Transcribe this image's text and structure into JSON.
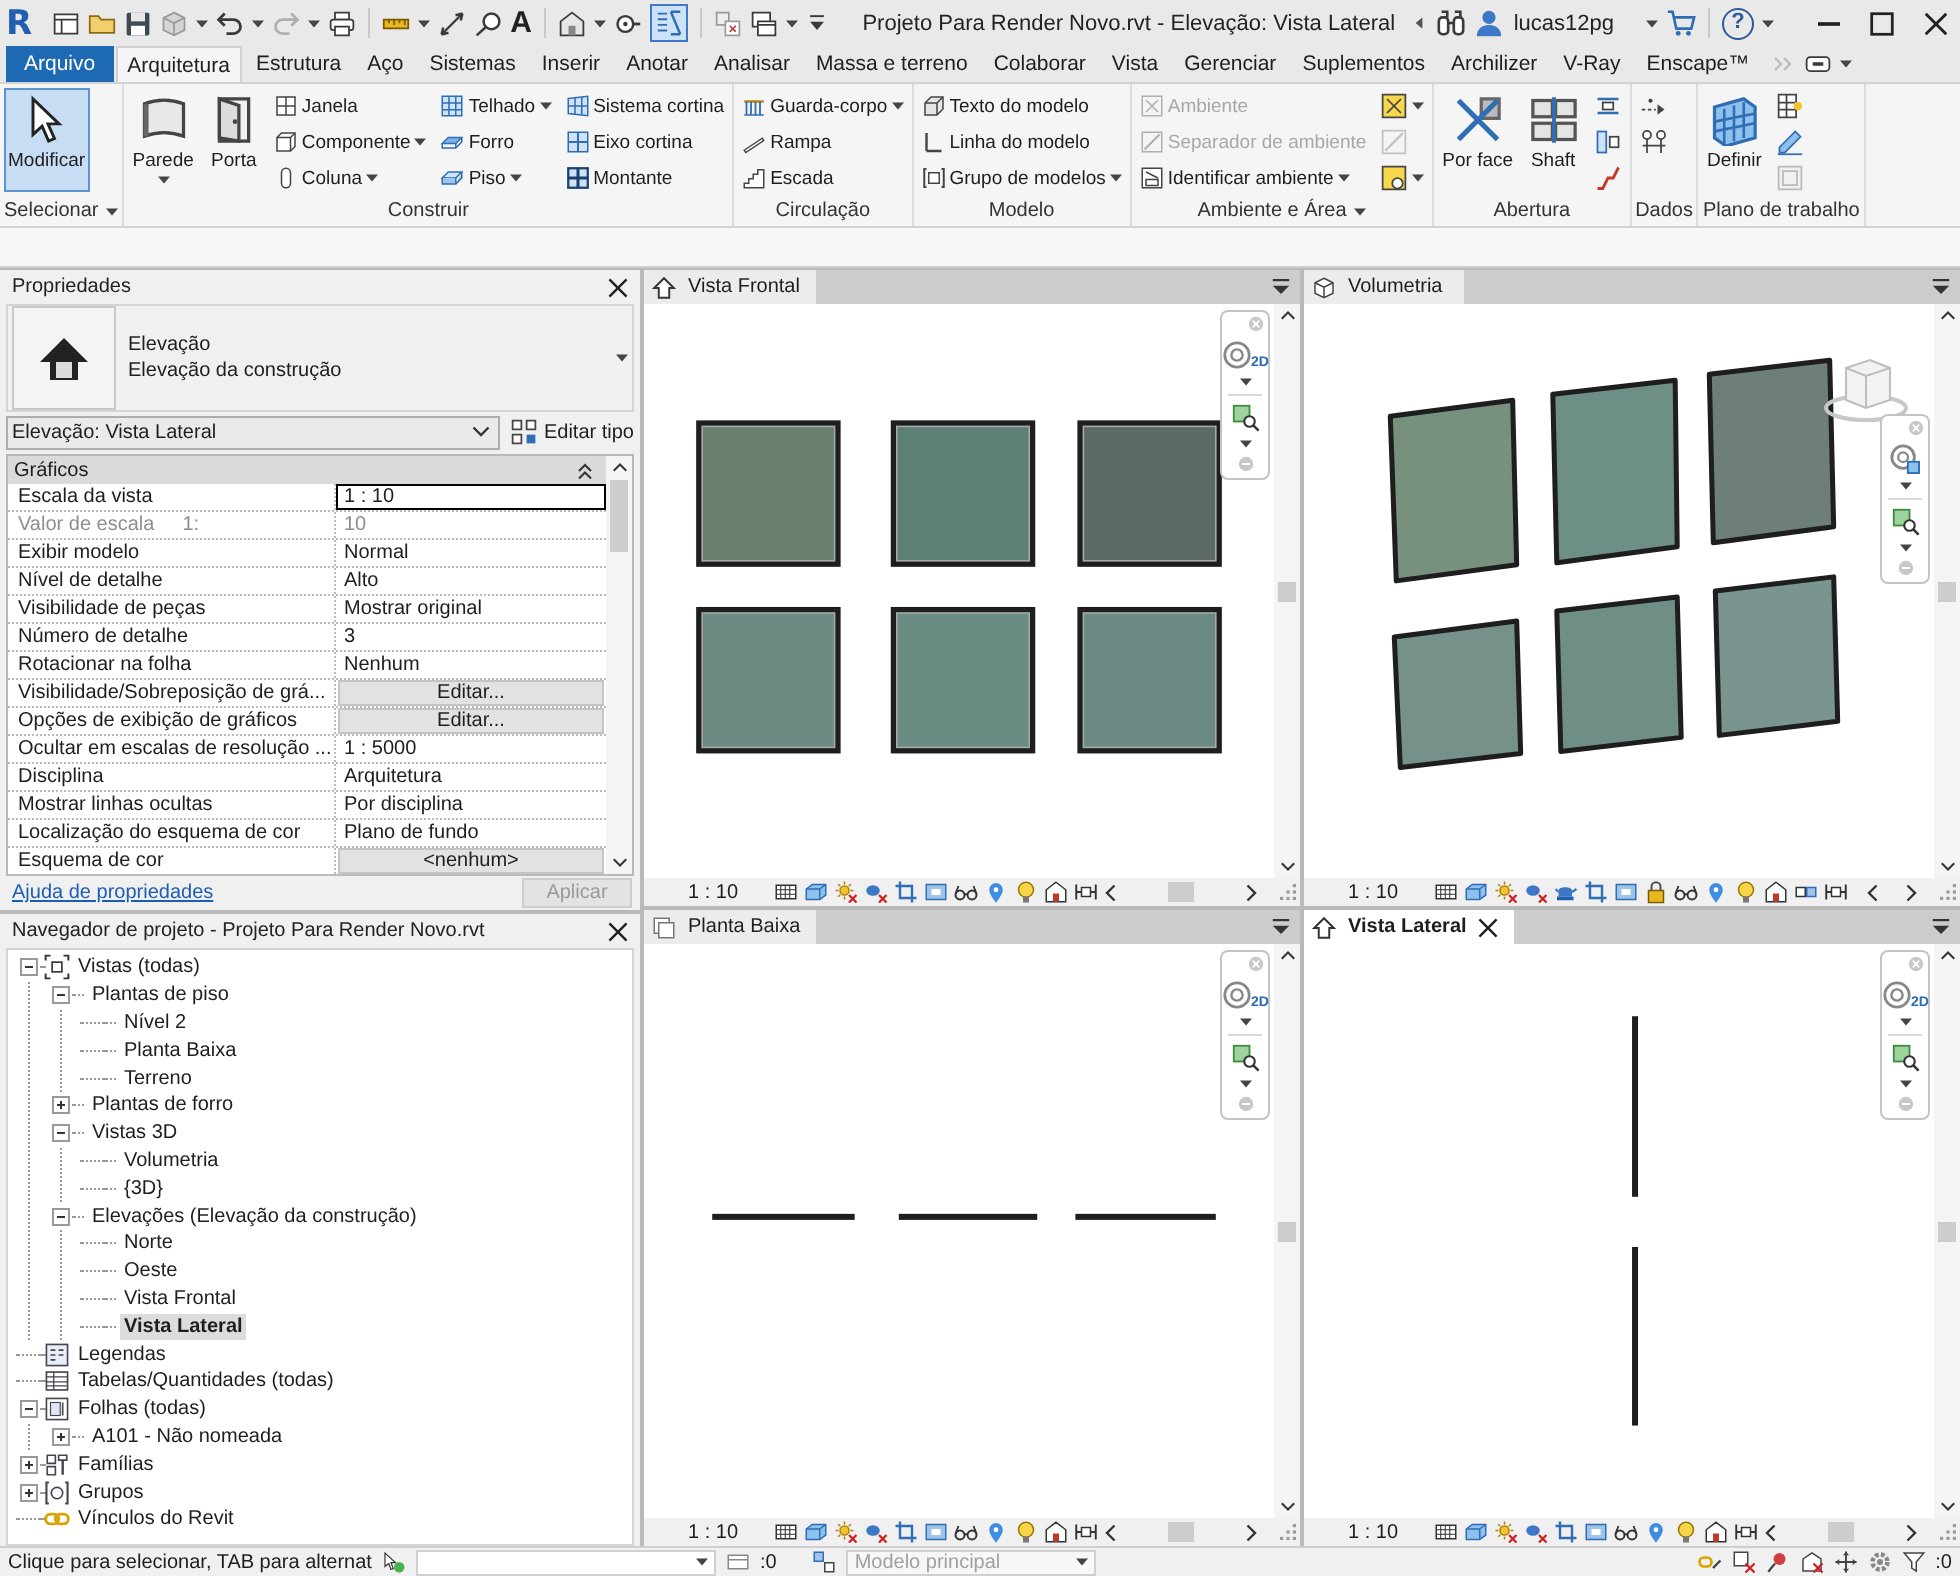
{
  "title_bar": {
    "logo": "R",
    "text_tool": "A",
    "thin_lines_selected": true,
    "title": "Projeto Para Render Novo.rvt - Elevação: Vista Lateral",
    "user": "lucas12pg",
    "help": "?"
  },
  "ribbon": {
    "tabs": [
      {
        "label": "Arquivo",
        "kind": "application",
        "selected": false
      },
      {
        "label": "Arquitetura",
        "kind": "tab",
        "selected": true
      },
      {
        "label": "Estrutura",
        "kind": "tab",
        "selected": false
      },
      {
        "label": "Aço",
        "kind": "tab",
        "selected": false
      },
      {
        "label": "Sistemas",
        "kind": "tab",
        "selected": false
      },
      {
        "label": "Inserir",
        "kind": "tab",
        "selected": false
      },
      {
        "label": "Anotar",
        "kind": "tab",
        "selected": false
      },
      {
        "label": "Analisar",
        "kind": "tab",
        "selected": false
      },
      {
        "label": "Massa e terreno",
        "kind": "tab",
        "selected": false
      },
      {
        "label": "Colaborar",
        "kind": "tab",
        "selected": false
      },
      {
        "label": "Vista",
        "kind": "tab",
        "selected": false
      },
      {
        "label": "Gerenciar",
        "kind": "tab",
        "selected": false
      },
      {
        "label": "Suplementos",
        "kind": "tab",
        "selected": false
      },
      {
        "label": "Archilizer",
        "kind": "tab",
        "selected": false
      },
      {
        "label": "V-Ray",
        "kind": "tab",
        "selected": false
      },
      {
        "label": "Enscape™",
        "kind": "tab",
        "selected": false
      }
    ],
    "panels": [
      {
        "title": "Selecionar",
        "has_menu": true,
        "columns": [
          [
            {
              "kind": "large",
              "label": "Modificar",
              "selected": true,
              "disabled": false,
              "has_menu": false
            }
          ]
        ]
      },
      {
        "title": "Construir",
        "has_menu": false,
        "columns": [
          [
            {
              "kind": "large",
              "label": "Parede",
              "selected": false,
              "disabled": false,
              "has_menu": true
            }
          ],
          [
            {
              "kind": "large",
              "label": "Porta",
              "selected": false,
              "disabled": false,
              "has_menu": false
            }
          ],
          [
            {
              "kind": "small",
              "label": "Janela",
              "selected": false,
              "disabled": false,
              "has_menu": false
            },
            {
              "kind": "small",
              "label": "Componente",
              "selected": false,
              "disabled": false,
              "has_menu": true
            },
            {
              "kind": "small",
              "label": "Coluna",
              "selected": false,
              "disabled": false,
              "has_menu": true
            }
          ],
          [
            {
              "kind": "small",
              "label": "Telhado",
              "selected": false,
              "disabled": false,
              "has_menu": true
            },
            {
              "kind": "small",
              "label": "Forro",
              "selected": false,
              "disabled": false,
              "has_menu": false
            },
            {
              "kind": "small",
              "label": "Piso",
              "selected": false,
              "disabled": false,
              "has_menu": true
            }
          ],
          [
            {
              "kind": "small",
              "label": "Sistema cortina",
              "selected": false,
              "disabled": false,
              "has_menu": false
            },
            {
              "kind": "small",
              "label": "Eixo cortina",
              "selected": false,
              "disabled": false,
              "has_menu": false
            },
            {
              "kind": "small",
              "label": "Montante",
              "selected": false,
              "disabled": false,
              "has_menu": false
            }
          ]
        ]
      },
      {
        "title": "Circulação",
        "has_menu": false,
        "columns": [
          [
            {
              "kind": "small",
              "label": "Guarda-corpo",
              "selected": false,
              "disabled": false,
              "has_menu": true
            },
            {
              "kind": "small",
              "label": "Rampa",
              "selected": false,
              "disabled": false,
              "has_menu": false
            },
            {
              "kind": "small",
              "label": "Escada",
              "selected": false,
              "disabled": false,
              "has_menu": false
            }
          ]
        ]
      },
      {
        "title": "Modelo",
        "has_menu": false,
        "columns": [
          [
            {
              "kind": "small",
              "label": "Texto do modelo",
              "selected": false,
              "disabled": false,
              "has_menu": false
            },
            {
              "kind": "small",
              "label": "Linha do modelo",
              "selected": false,
              "disabled": false,
              "has_menu": false
            },
            {
              "kind": "small",
              "label": "Grupo de modelos",
              "selected": false,
              "disabled": false,
              "has_menu": true
            }
          ]
        ]
      },
      {
        "title": "Ambiente e Área",
        "has_menu": true,
        "columns": [
          [
            {
              "kind": "small",
              "label": "Ambiente",
              "selected": false,
              "disabled": true,
              "has_menu": false
            },
            {
              "kind": "small",
              "label": "Separador de ambiente",
              "selected": false,
              "disabled": true,
              "has_menu": false
            },
            {
              "kind": "small",
              "label": "Identificar ambiente",
              "selected": false,
              "disabled": false,
              "has_menu": true
            }
          ],
          [
            {
              "kind": "icon",
              "selected": false,
              "disabled": false,
              "has_menu": true
            },
            {
              "kind": "icon",
              "selected": false,
              "disabled": true,
              "has_menu": false
            },
            {
              "kind": "icon",
              "selected": false,
              "disabled": false,
              "has_menu": true
            }
          ]
        ]
      },
      {
        "title": "Abertura",
        "has_menu": false,
        "columns": [
          [
            {
              "kind": "large",
              "label": "Por face",
              "selected": false,
              "disabled": false,
              "has_menu": false
            }
          ],
          [
            {
              "kind": "large",
              "label": "Shaft",
              "selected": false,
              "disabled": false,
              "has_menu": false
            }
          ],
          [
            {
              "kind": "icon",
              "selected": false,
              "disabled": false,
              "has_menu": false
            },
            {
              "kind": "icon",
              "selected": false,
              "disabled": false,
              "has_menu": false
            },
            {
              "kind": "icon",
              "selected": false,
              "disabled": false,
              "has_menu": false
            }
          ]
        ]
      },
      {
        "title": "Dados",
        "has_menu": false,
        "columns": [
          [
            {
              "kind": "icon",
              "selected": false,
              "disabled": false,
              "has_menu": false
            },
            {
              "kind": "icon",
              "selected": false,
              "disabled": false,
              "has_menu": false
            }
          ]
        ]
      },
      {
        "title": "Plano de trabalho",
        "has_menu": false,
        "columns": [
          [
            {
              "kind": "large",
              "label": "Definir",
              "selected": false,
              "disabled": false,
              "has_menu": false
            }
          ],
          [
            {
              "kind": "icon",
              "selected": false,
              "disabled": false,
              "has_menu": false
            },
            {
              "kind": "icon",
              "selected": false,
              "disabled": false,
              "has_menu": false
            },
            {
              "kind": "icon",
              "selected": false,
              "disabled": true,
              "has_menu": false
            }
          ]
        ]
      }
    ]
  },
  "properties": {
    "title": "Propriedades",
    "type_name": "Elevação",
    "type_family": "Elevação da construção",
    "instance_selector": "Elevação: Vista Lateral",
    "edit_type": "Editar tipo",
    "sections": [
      {
        "title": "Gráficos",
        "expanded": true,
        "rows": [
          {
            "name": "Escala da vista",
            "value": "1 : 10",
            "kind": "text",
            "selected": true,
            "disabled": false
          },
          {
            "name": "Valor de escala",
            "suffix": "1:",
            "value": "10",
            "kind": "text",
            "selected": false,
            "disabled": true
          },
          {
            "name": "Exibir modelo",
            "value": "Normal",
            "kind": "text",
            "selected": false,
            "disabled": false
          },
          {
            "name": "Nível de detalhe",
            "value": "Alto",
            "kind": "text",
            "selected": false,
            "disabled": false
          },
          {
            "name": "Visibilidade de peças",
            "value": "Mostrar original",
            "kind": "text",
            "selected": false,
            "disabled": false
          },
          {
            "name": "Número de detalhe",
            "value": "3",
            "kind": "text",
            "selected": false,
            "disabled": false
          },
          {
            "name": "Rotacionar na folha",
            "value": "Nenhum",
            "kind": "text",
            "selected": false,
            "disabled": false
          },
          {
            "name": "Visibilidade/Sobreposição de grá...",
            "value": "Editar...",
            "kind": "button",
            "selected": false,
            "disabled": false
          },
          {
            "name": "Opções de exibição de gráficos",
            "value": "Editar...",
            "kind": "button",
            "selected": false,
            "disabled": false
          },
          {
            "name": "Ocultar em escalas de resolução ...",
            "value": "1 : 5000",
            "kind": "text",
            "selected": false,
            "disabled": false
          },
          {
            "name": "Disciplina",
            "value": "Arquitetura",
            "kind": "text",
            "selected": false,
            "disabled": false
          },
          {
            "name": "Mostrar linhas ocultas",
            "value": "Por disciplina",
            "kind": "text",
            "selected": false,
            "disabled": false
          },
          {
            "name": "Localização do esquema de cor",
            "value": "Plano de fundo",
            "kind": "text",
            "selected": false,
            "disabled": false
          },
          {
            "name": "Esquema de cor",
            "value": "<nenhum>",
            "kind": "button",
            "selected": false,
            "disabled": false
          }
        ]
      }
    ],
    "help_link": "Ajuda de propriedades",
    "apply": {
      "label": "Aplicar",
      "disabled": true
    }
  },
  "project_browser": {
    "title": "Navegador de projeto - Projeto Para Render Novo.rvt",
    "items": [
      {
        "label": "Vistas (todas)",
        "selected": false,
        "expanded": true,
        "children": [
          {
            "label": "Plantas de piso",
            "selected": false,
            "expanded": true,
            "children": [
              {
                "label": "Nível 2",
                "selected": false
              },
              {
                "label": "Planta Baixa",
                "selected": false
              },
              {
                "label": "Terreno",
                "selected": false
              }
            ]
          },
          {
            "label": "Plantas de forro",
            "selected": false,
            "expanded": false
          },
          {
            "label": "Vistas 3D",
            "selected": false,
            "expanded": true,
            "children": [
              {
                "label": "Volumetria",
                "selected": false
              },
              {
                "label": "{3D}",
                "selected": false
              }
            ]
          },
          {
            "label": "Elevações (Elevação da construção)",
            "selected": false,
            "expanded": true,
            "children": [
              {
                "label": "Norte",
                "selected": false
              },
              {
                "label": "Oeste",
                "selected": false
              },
              {
                "label": "Vista Frontal",
                "selected": false
              },
              {
                "label": "Vista Lateral",
                "selected": true
              }
            ]
          }
        ]
      },
      {
        "label": "Legendas",
        "selected": false
      },
      {
        "label": "Tabelas/Quantidades (todas)",
        "selected": false
      },
      {
        "label": "Folhas (todas)",
        "selected": false,
        "expanded": true,
        "children": [
          {
            "label": "A101 - Não nomeada",
            "selected": false,
            "expanded": false
          }
        ]
      },
      {
        "label": "Famílias",
        "selected": false,
        "expanded": false
      },
      {
        "label": "Grupos",
        "selected": false,
        "expanded": false
      },
      {
        "label": "Vínculos do Revit",
        "selected": false
      }
    ]
  },
  "views": [
    {
      "title": "Vista Frontal",
      "kind": "front_elevation",
      "selected": false,
      "scale": "1 : 10",
      "nav_badge": "2D"
    },
    {
      "title": "Volumetria",
      "kind": "perspective",
      "selected": false,
      "scale": "1 : 10"
    },
    {
      "title": "Planta Baixa",
      "kind": "plan",
      "selected": false,
      "scale": "1 : 10",
      "nav_badge": "2D"
    },
    {
      "title": "Vista Lateral",
      "kind": "side_elevation",
      "selected": true,
      "scale": "1 : 10",
      "nav_badge": "2D"
    }
  ],
  "status_bar": {
    "hint": "Clique para selecionar, TAB para alternat",
    "workset_count": ":0",
    "model": {
      "label": "Modelo principal",
      "disabled": true
    },
    "filter_count": ":0"
  }
}
